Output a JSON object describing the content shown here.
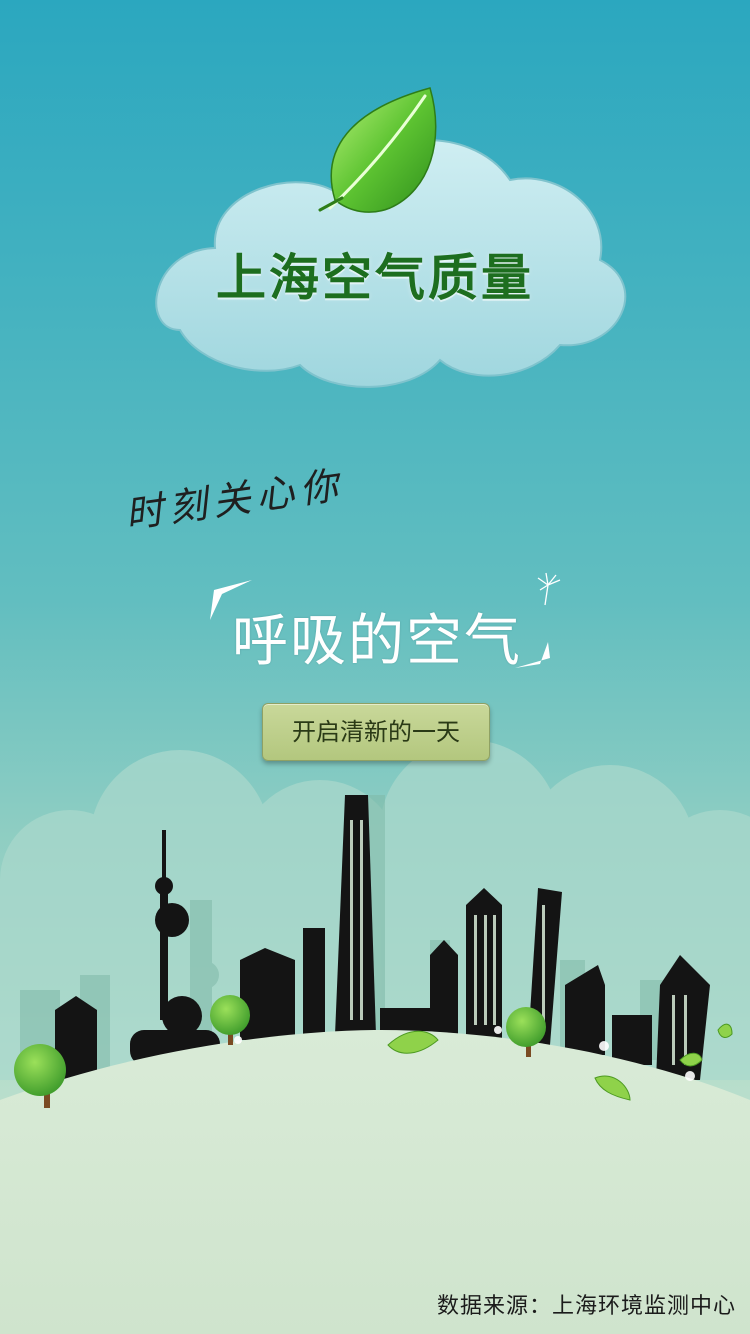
{
  "app": {
    "title": "上海空气质量"
  },
  "tagline": {
    "line1": "时刻关心你",
    "line2": "呼吸的空气"
  },
  "start_button": {
    "label": "开启清新的一天"
  },
  "footer": {
    "data_source": "数据来源：上海环境监测中心"
  },
  "colors": {
    "sky_top": "#2ba7bf",
    "sky_bottom": "#d9ecd8",
    "title_green": "#1d6e1f",
    "button_fill": "#c0d28d",
    "skyline": "#111111"
  },
  "icons": {
    "logo": "green-leaf-icon"
  }
}
